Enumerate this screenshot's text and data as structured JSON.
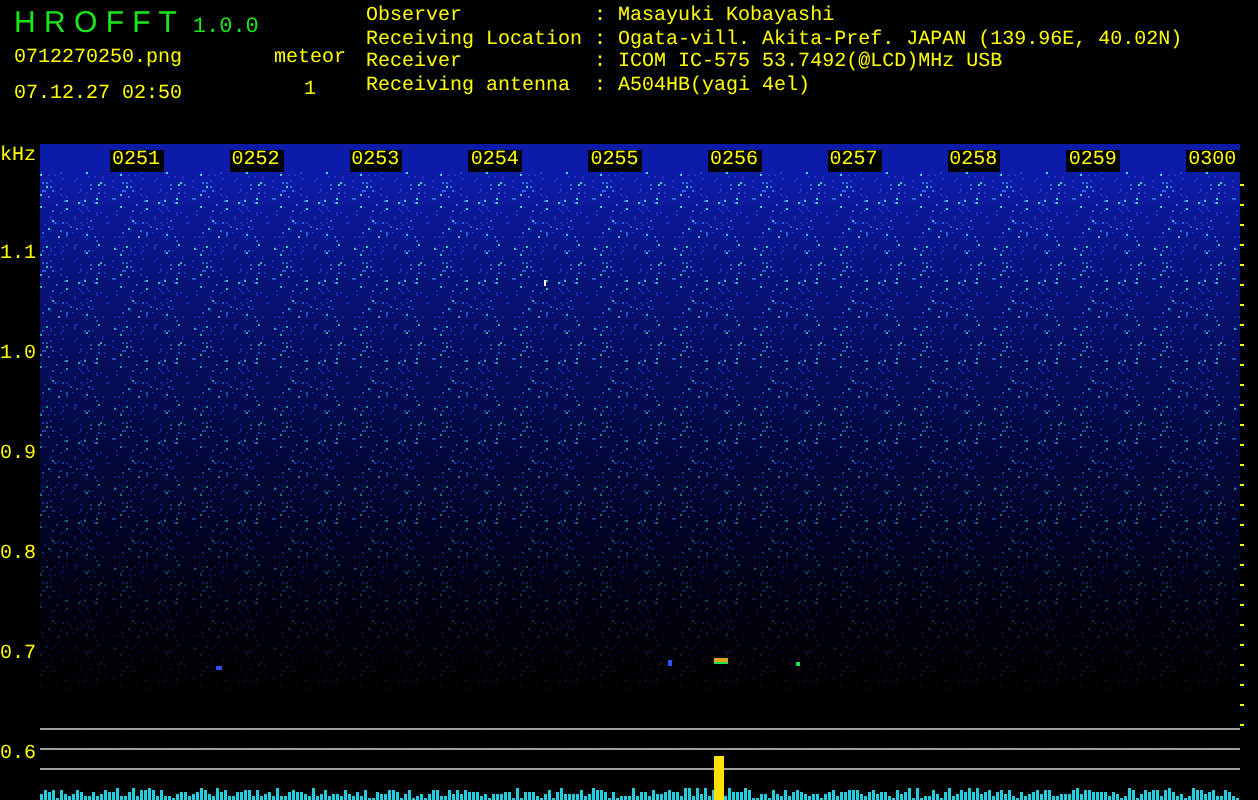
{
  "app": {
    "title": "H R O F F T",
    "version": "1.0.0"
  },
  "file": {
    "name": "0712270250.png",
    "datetime": "07.12.27 02:50"
  },
  "meteor": {
    "label": "meteor",
    "count": "1"
  },
  "info": [
    {
      "label": "Observer",
      "separator": ":",
      "value": "Masayuki Kobayashi"
    },
    {
      "label": "Receiving Location",
      "separator": ":",
      "value": "Ogata-vill. Akita-Pref. JAPAN (139.96E, 40.02N)"
    },
    {
      "label": "Receiver",
      "separator": ":",
      "value": "ICOM IC-575 53.7492(@LCD)MHz USB"
    },
    {
      "label": "Receiving antenna",
      "separator": ":",
      "value": "A504HB(yagi 4el)"
    }
  ],
  "y_axis": {
    "unit": "kHz",
    "labels": [
      "1.1",
      "1.0",
      "0.9",
      "0.8",
      "0.7",
      "0.6"
    ]
  },
  "time_labels": [
    "0251",
    "0252",
    "0253",
    "0254",
    "0255",
    "0256",
    "0257",
    "0258",
    "0259",
    "0300"
  ]
}
